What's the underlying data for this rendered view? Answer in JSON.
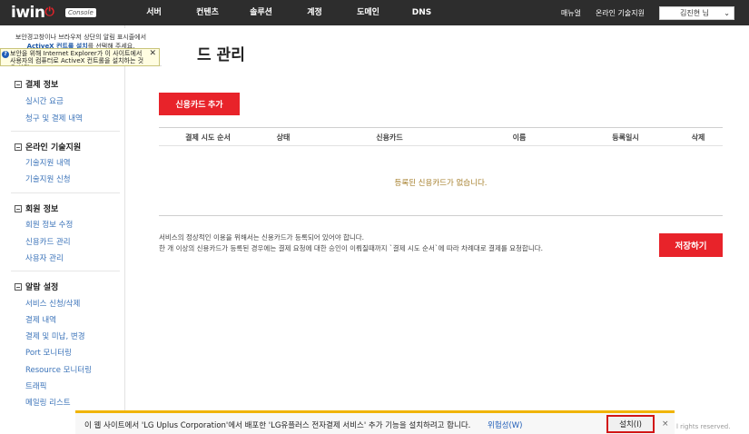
{
  "header": {
    "logo": "iwin",
    "console": "Console",
    "nav": [
      "서버",
      "컨텐츠",
      "솔루션",
      "계정",
      "도메인",
      "DNS"
    ],
    "links": [
      "매뉴얼",
      "온라인 기술지원"
    ],
    "user": "김진현 님"
  },
  "ie_warning": {
    "line1": "보안경고창이나 브라우저 상단의 알림 표시줄에서",
    "line2_bold": "ActiveX 컨트롤 설치",
    "line2_rest": "를 선택해 주세요.",
    "bar_text": "보안을 위해 Internet Explorer가 이 사이트에서 사용자의 컴퓨터로 ActiveX 컨트롤을 설치하는 것을 차단..."
  },
  "sidebar": {
    "groups": [
      {
        "title": "결제 정보",
        "items": [
          "실시간 요금",
          "청구 및 결제 내역"
        ]
      },
      {
        "title": "온라인 기술지원",
        "items": [
          "기술지원 내역",
          "기술지원 신청"
        ]
      },
      {
        "title": "회원 정보",
        "items": [
          "회원 정보 수정",
          "신용카드 관리",
          "사용자 관리"
        ]
      },
      {
        "title": "알람 설정",
        "items": [
          "서비스 신청/삭제",
          "결제 내역",
          "결제 및 미납, 변경",
          "Port 모니터링",
          "Resource 모니터링",
          "트래픽",
          "메일링 리스트"
        ]
      }
    ]
  },
  "main": {
    "title": "드 관리",
    "add_button": "신용카드 추가",
    "columns": [
      "결제 시도 순서",
      "상태",
      "신용카드",
      "이름",
      "등록일시",
      "삭제"
    ],
    "empty": "등록된 신용카드가 없습니다.",
    "notice_line1": "서비스의 정상적인 이용을 위해서는 신용카드가 등록되어 있어야 합니다.",
    "notice_line2": "한 개 이상의 신용카드가 등록된 경우에는 결제 요청에 대한 승인이 이뤄질때까지 `결제 시도 순서`에 따라 차례대로 결제를 요청합니다.",
    "save_button": "저장하기"
  },
  "install_bar": {
    "text": "이 웹 사이트에서 'LG Uplus Corporation'에서 배포한 'LG유플러스 전자결제 서비스' 추가 기능을 설치하려고 합니다.",
    "risk": "위험성(W)",
    "install": "설치(I)",
    "close": "×"
  },
  "footer": {
    "rights": "l rights reserved."
  }
}
